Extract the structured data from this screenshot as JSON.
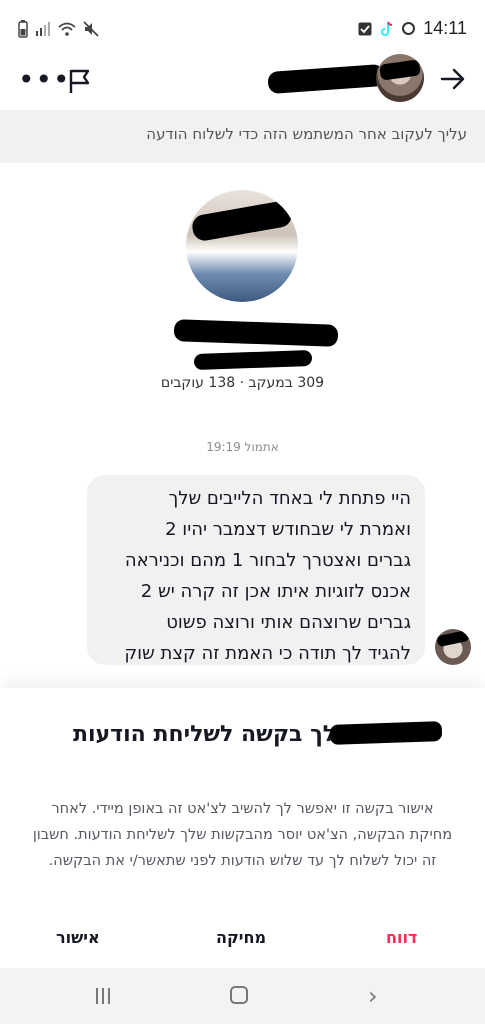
{
  "status_bar": {
    "time": "14:11",
    "left_icons": [
      "battery-icon",
      "signal-icon",
      "wifi-icon",
      "mute-icon"
    ],
    "right_icons": [
      "check-notification-icon",
      "tiktok-icon",
      "b-icon"
    ]
  },
  "header": {
    "more_icon": "more-icon",
    "flag_icon": "flag-icon",
    "back_icon": "arrow-right-icon"
  },
  "banner": {
    "text": "עליך לעקוב אחר המשתמש הזה כדי לשלוח הודעה"
  },
  "profile": {
    "stats": "309 במעקב · 138 עוקבים"
  },
  "chat": {
    "timestamp": "אתמול 19:19",
    "message": "היי פתחת לי באחד הלייבים שלך\nואמרת לי שבחודש דצמבר יהיו 2\nגברים ואצטרך לבחור 1 מהם וכניראה\nאכנס לזוגיות איתו אכן זה קרה יש 2\nגברים שרוצהם אותי ורוצה פשוט\nלהגיד לך תודה כי האמת זה קצת שוק"
  },
  "request_sheet": {
    "title": "שלח/ה לך בקשה לשליחת הודעות",
    "description": "אישור בקשה זו יאפשר לך להשיב לצ'אט זה באופן מיידי. לאחר מחיקת הבקשה, הצ'אט יוסר מהבקשות שלך לשליחת הודעות. חשבון זה יכול לשלוח לך עד שלוש הודעות לפני שתאשר/י את הבקשה.",
    "report_label": "דווח",
    "delete_label": "מחיקה",
    "accept_label": "אישור",
    "report_color": "#fe2c55"
  },
  "nav_bar": {
    "icons": [
      "recent-apps-icon",
      "home-icon",
      "back-icon"
    ]
  }
}
